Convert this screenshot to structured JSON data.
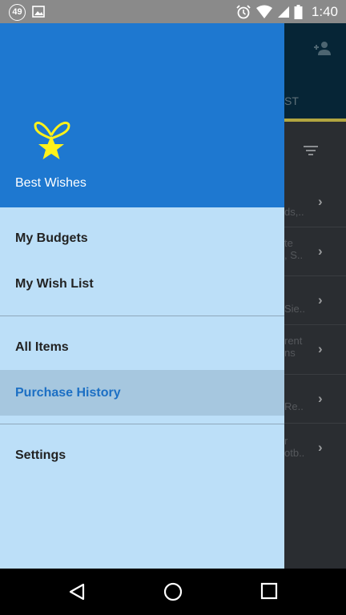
{
  "status_bar": {
    "notification_count": "49",
    "time": "1:40",
    "icons": [
      "image-icon",
      "alarm-icon",
      "wifi-icon",
      "signal-icon",
      "battery-icon"
    ]
  },
  "background_app": {
    "tab_fragment": "ST",
    "rows": [
      {
        "text": "ds,.."
      },
      {
        "text": "te\n, S.."
      },
      {
        "text": "Sie.."
      },
      {
        "text": "rent\nns"
      },
      {
        "text": "Re.."
      },
      {
        "text": "r\notb.."
      }
    ]
  },
  "drawer": {
    "header": {
      "app_name": "Best Wishes",
      "logo": "gift-star-icon"
    },
    "menu": [
      {
        "label": "My Budgets"
      },
      {
        "label": "My Wish List"
      },
      {
        "label": "All Items"
      },
      {
        "label": "Purchase History",
        "active": true
      },
      {
        "label": "Settings"
      }
    ]
  },
  "navigation_bar": {
    "buttons": [
      "back",
      "home",
      "recents"
    ]
  },
  "colors": {
    "header": "#1e78d0",
    "drawer_bg": "#bcdff8",
    "active_item_bg": "#a6c7df",
    "active_item_text": "#1c6fc4",
    "logo_yellow": "#fff21a"
  }
}
